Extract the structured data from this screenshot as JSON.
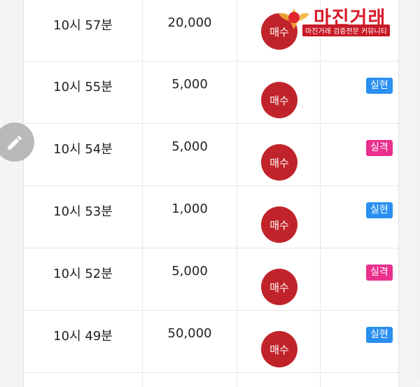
{
  "rows": [
    {
      "time": "10시 57분",
      "amount": "20,000",
      "action": "매수",
      "result": "",
      "result_type": "none"
    },
    {
      "time": "10시 55분",
      "amount": "5,000",
      "action": "매수",
      "result": "실현",
      "result_type": "real"
    },
    {
      "time": "10시 54분",
      "amount": "5,000",
      "action": "매수",
      "result": "실격",
      "result_type": "fail"
    },
    {
      "time": "10시 53분",
      "amount": "1,000",
      "action": "매수",
      "result": "실현",
      "result_type": "real"
    },
    {
      "time": "10시 52분",
      "amount": "5,000",
      "action": "매수",
      "result": "실격",
      "result_type": "fail"
    },
    {
      "time": "10시 49분",
      "amount": "50,000",
      "action": "매수",
      "result": "실현",
      "result_type": "real"
    }
  ],
  "watermark": {
    "title": "마진거래",
    "subtitle": "마진거래 검증전문 커뮤니티"
  },
  "icons": {
    "edit": "pencil-icon"
  },
  "colors": {
    "buy": "#c0242a",
    "real": "#2a8ff0",
    "fail": "#ea2f8c"
  }
}
